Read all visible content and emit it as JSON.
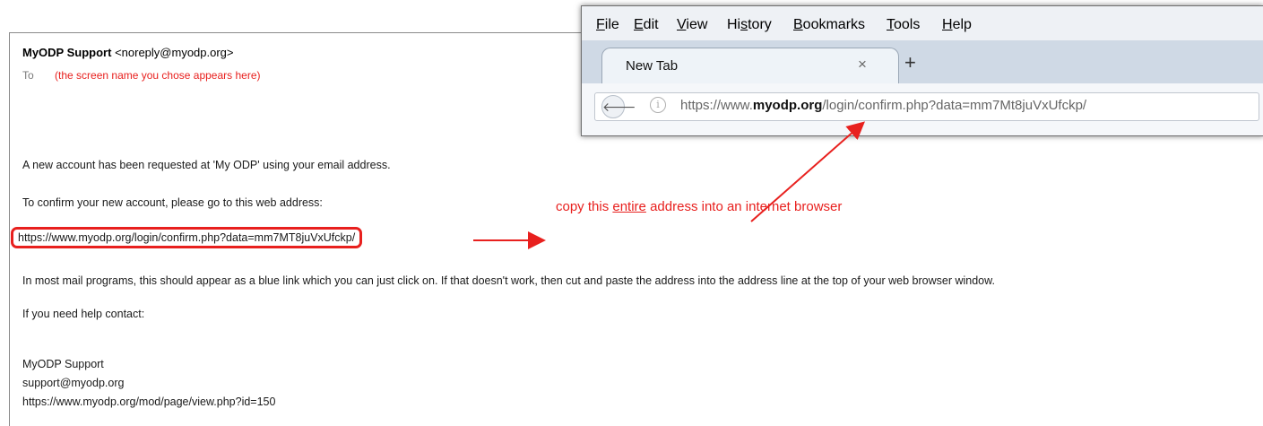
{
  "email": {
    "sender_name": "MyODP Support",
    "sender_email": "<noreply@myodp.org>",
    "to_label": "To",
    "to_note": "(the screen name you chose appears here)",
    "line1": "A new account has been requested at 'My ODP' using your email address.",
    "line2": "To confirm your new account, please go to this web address:",
    "confirm_url": "https://www.myodp.org/login/confirm.php?data=mm7MT8juVxUfckp/",
    "line3": "In most mail programs, this should appear as a blue link which you can just click on. If that doesn't work, then cut and paste the address into the address line at the top of your web browser window.",
    "line4": "If you need help contact:",
    "sig_name": "MyODP Support",
    "sig_email": "support@myodp.org",
    "sig_url": "https://www.myodp.org/mod/page/view.php?id=150"
  },
  "annotation": {
    "text_before": "copy this ",
    "text_underlined": "entire",
    "text_after": " address into an internet browser"
  },
  "browser": {
    "menu": [
      "File",
      "Edit",
      "View",
      "History",
      "Bookmarks",
      "Tools",
      "Help"
    ],
    "tab_title": "New Tab",
    "tab_close": "×",
    "new_tab": "+",
    "url_prefix": "https://www.",
    "url_domain": "myodp.org",
    "url_rest": "/login/confirm.php?data=mm7Mt8juVxUfckp/",
    "back_glyph": "🡐",
    "info_glyph": "i"
  },
  "colors": {
    "annotation": "#e8201e"
  }
}
